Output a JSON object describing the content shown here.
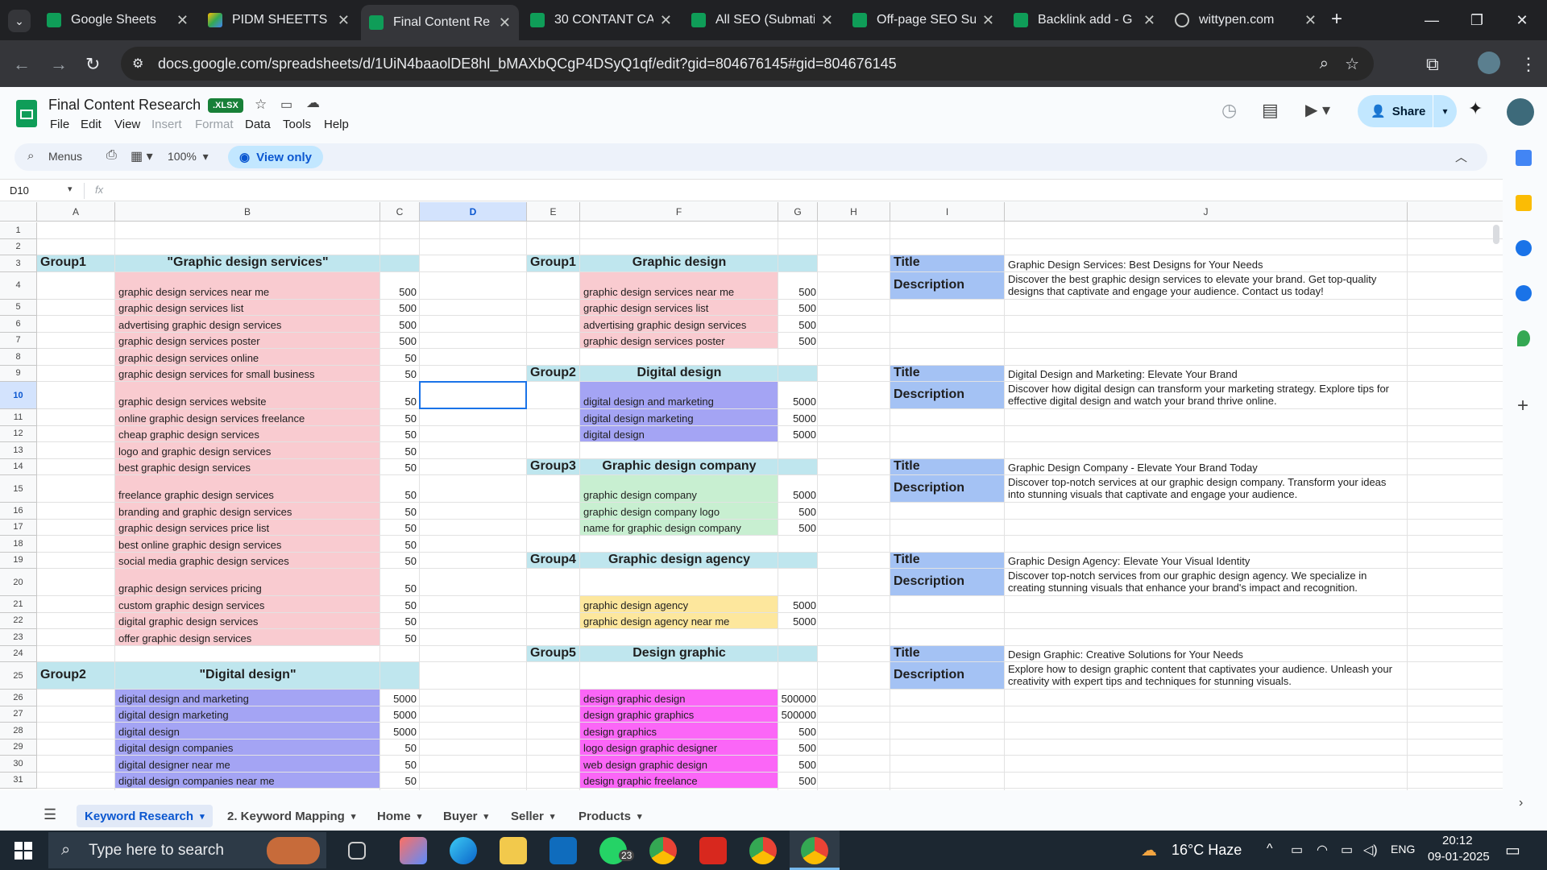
{
  "browser": {
    "tabs": [
      {
        "title": "Google Sheets",
        "icon": "sheets-icon",
        "x": 0
      },
      {
        "title": "PIDM SHEETTS -",
        "icon": "drive-icon",
        "x": 0
      },
      {
        "title": "Final Content Re",
        "icon": "sheets-icon",
        "x": 0
      },
      {
        "title": "30 CONTANT CA",
        "icon": "sheets-icon",
        "x": 0
      },
      {
        "title": "All SEO (Submati",
        "icon": "sheets-icon",
        "x": 0
      },
      {
        "title": "Off-page SEO Su",
        "icon": "sheets-icon",
        "x": 0
      },
      {
        "title": "Backlink add - G",
        "icon": "sheets-icon",
        "x": 0
      },
      {
        "title": "wittypen.com",
        "icon": "globe-icon",
        "x": 0
      }
    ],
    "url": "docs.google.com/spreadsheets/d/1UiN4baaolDE8hl_bMAXbQCgP4DSyQ1qf/edit?gid=804676145#gid=804676145"
  },
  "doc": {
    "title": "Final Content Research",
    "badge": ".XLSX",
    "menus": [
      "File",
      "Edit",
      "View",
      "Insert",
      "Format",
      "Data",
      "Tools",
      "Help"
    ],
    "share_label": "Share"
  },
  "toolbar": {
    "menus_label": "Menus",
    "zoom": "100%",
    "view_only": "View only"
  },
  "formula": {
    "cell_ref": "D10",
    "fx": "fx"
  },
  "columns": [
    "A",
    "B",
    "C",
    "D",
    "E",
    "F",
    "G",
    "H",
    "I",
    "J"
  ],
  "rows": [
    "1",
    "2",
    "3",
    "4",
    "5",
    "6",
    "7",
    "8",
    "9",
    "10",
    "11",
    "12",
    "13",
    "14",
    "15",
    "16",
    "17",
    "18",
    "19",
    "20",
    "21",
    "22",
    "23",
    "24",
    "25",
    "26",
    "27",
    "28",
    "29",
    "30",
    "31"
  ],
  "cells": {
    "A3": "Group1",
    "B3": "\"Graphic design services\"",
    "B4": "graphic design services near me",
    "C4": "500",
    "B5": "graphic design services list",
    "C5": "500",
    "B6": "advertising graphic design services",
    "C6": "500",
    "B7": "graphic design services poster",
    "C7": "500",
    "B8": "graphic design services online",
    "C8": "50",
    "B9": "graphic design services for small business",
    "C9": "50",
    "B10": "graphic design services website",
    "C10": "50",
    "B11": "online graphic design services freelance",
    "C11": "50",
    "B12": "cheap graphic design services",
    "C12": "50",
    "B13": "logo and graphic design services",
    "C13": "50",
    "B14": "best graphic design services",
    "C14": "50",
    "B15": "freelance graphic design services",
    "C15": "50",
    "B16": "branding and graphic design services",
    "C16": "50",
    "B17": "graphic design services price list",
    "C17": "50",
    "B18": "best online graphic design services",
    "C18": "50",
    "B19": "social media graphic design services",
    "C19": "50",
    "B20": "graphic design services pricing",
    "C20": "50",
    "B21": "custom graphic design services",
    "C21": "50",
    "B22": "digital graphic design services",
    "C22": "50",
    "B23": "offer graphic design services",
    "C23": "50",
    "A25": "Group2",
    "B25": "\"Digital design\"",
    "B26": "digital design and marketing",
    "C26": "5000",
    "B27": "digital design marketing",
    "C27": "5000",
    "B28": "digital design",
    "C28": "5000",
    "B29": "digital design companies",
    "C29": "50",
    "B30": "digital designer near me",
    "C30": "50",
    "B31": "digital design companies near me",
    "C31": "50",
    "E3": "Group1",
    "F3": "Graphic design",
    "F4": "graphic design services near me",
    "G4": "500",
    "F5": "graphic design services list",
    "G5": "500",
    "F6": "advertising graphic design services",
    "G6": "500",
    "F7": "graphic design services poster",
    "G7": "500",
    "E9": "Group2",
    "F9": "Digital design",
    "F10": "digital design and marketing",
    "G10": "5000",
    "F11": "digital design marketing",
    "G11": "5000",
    "F12": "digital design",
    "G12": "5000",
    "E14": "Group3",
    "F14": "Graphic design company",
    "F15": "graphic design company",
    "G15": "5000",
    "F16": "graphic design company logo",
    "G16": "500",
    "F17": "name for graphic design company",
    "G17": "500",
    "E19": "Group4",
    "F19": "Graphic design agency",
    "F21": "graphic design agency",
    "G21": "5000",
    "F22": "graphic design agency near me",
    "G22": "5000",
    "E24": "Group5",
    "F24": "Design graphic",
    "F26": "design graphic design",
    "G26": "500000",
    "F27": "design graphic graphics",
    "G27": "500000",
    "F28": "design graphics",
    "G28": "500",
    "F29": "logo design graphic designer",
    "G29": "500",
    "F30": "web design graphic design",
    "G30": "500",
    "F31": "design graphic freelance",
    "G31": "500",
    "I3": "Title",
    "J3": "Graphic Design Services: Best Designs for Your Needs",
    "I4": "Description",
    "J4": "Discover the best graphic design services to elevate your brand. Get top-quality designs that captivate and engage your audience. Contact us today!",
    "I9": "Title",
    "J9": "Digital Design and Marketing: Elevate Your Brand",
    "I10": "Description",
    "J10": "Discover how digital design can transform your marketing strategy. Explore tips for effective digital design and watch your brand thrive online.",
    "I14": "Title",
    "J14": "Graphic Design Company - Elevate Your Brand Today",
    "I15": "Description",
    "J15": "Discover top-notch services at our graphic design company. Transform your ideas into stunning visuals that captivate and engage your audience.",
    "I19": "Title",
    "J19": "Graphic Design Agency: Elevate Your Visual Identity",
    "I20": "Description",
    "J20": "Discover top-notch services from our graphic design agency. We specialize in creating stunning visuals that enhance your brand's impact and recognition.",
    "I24": "Title",
    "J24": "Design Graphic: Creative Solutions for Your Needs",
    "I25": "Description",
    "J25": "Explore how to design graphic content that captivates your audience. Unleash your creativity with expert tips and techniques for stunning visuals."
  },
  "colors": {
    "cyan": "#bfe6ee",
    "pink": "#f9cbd0",
    "purple": "#a4a4f4",
    "green": "#c8efd1",
    "yellow": "#fde79d",
    "magenta": "#fb66f7",
    "blue": "#a4c2f4"
  },
  "sheets": [
    "Keyword Research",
    "2. Keyword Mapping",
    "Home",
    "Buyer",
    "Seller",
    "Products"
  ],
  "taskbar": {
    "search_placeholder": "Type here to search",
    "weather": "16°C  Haze",
    "lang": "ENG",
    "time": "20:12",
    "date": "09-01-2025",
    "whatsapp_badge": "23"
  }
}
